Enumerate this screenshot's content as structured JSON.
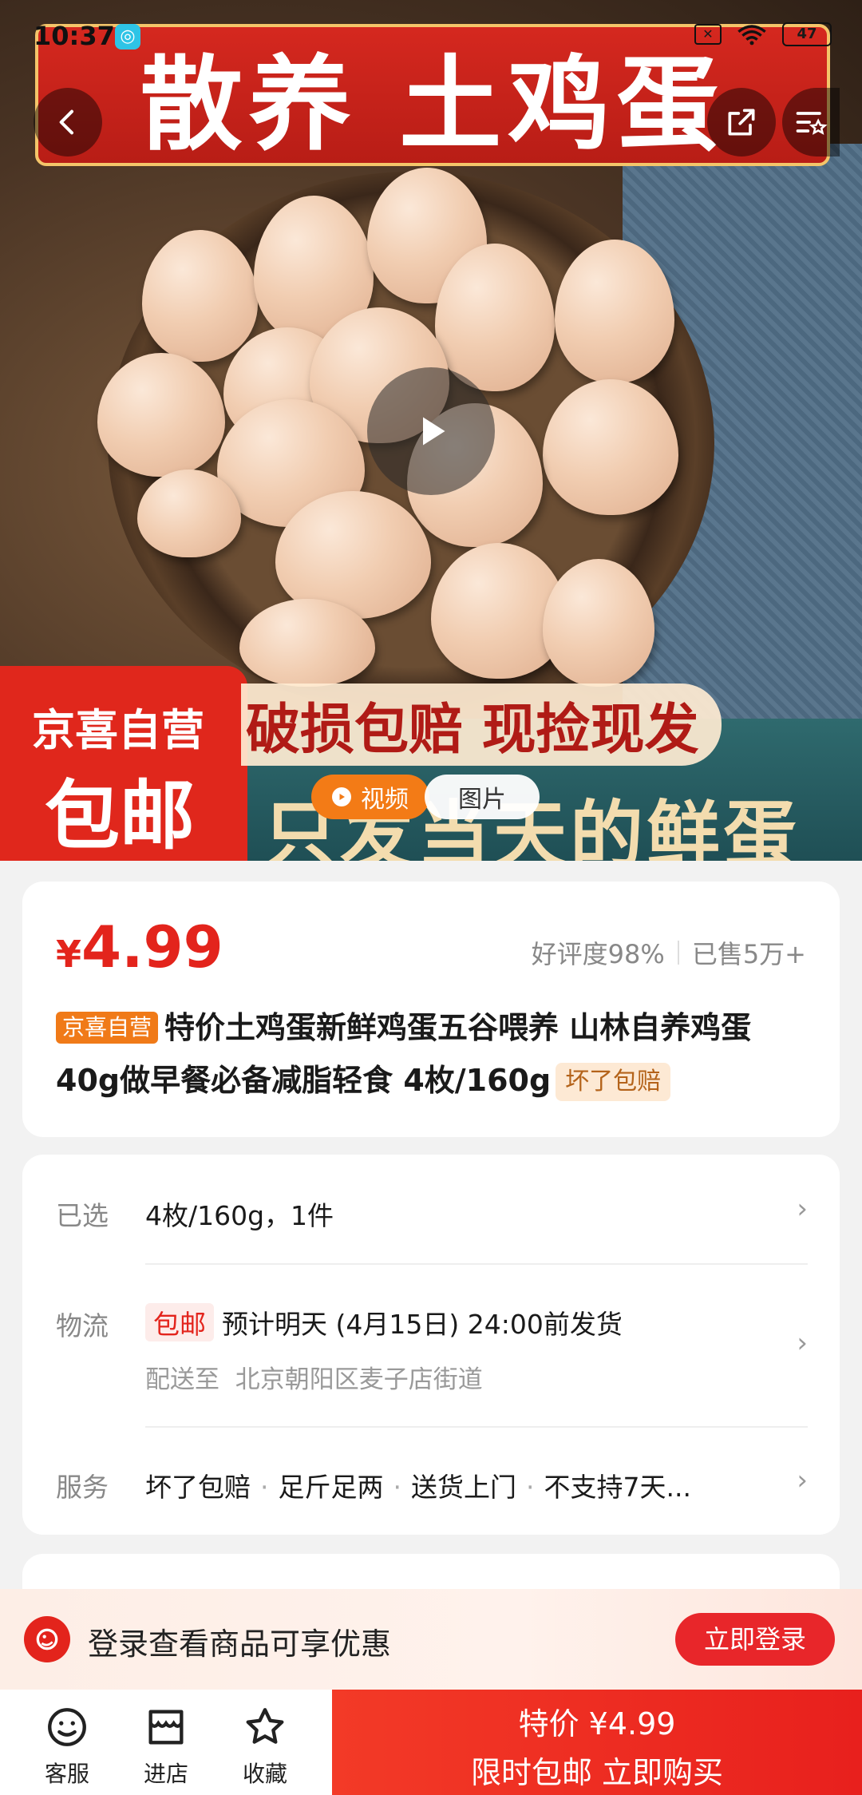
{
  "status_bar": {
    "time": "10:37",
    "battery": "47"
  },
  "hero": {
    "banner_title": "散养 土鸡蛋",
    "badge_line1": "京喜自营",
    "badge_line2": "包邮",
    "slogan1": "破损包赔 现捡现发",
    "slogan2": "只发当天的鲜蛋",
    "media_tabs": [
      {
        "label": "视频",
        "active": true
      },
      {
        "label": "图片",
        "active": false
      }
    ]
  },
  "product": {
    "price_symbol": "¥",
    "price": "4.99",
    "rating": "好评度98%",
    "sold": "已售5万+",
    "tag_store": "京喜自营",
    "title": "特价土鸡蛋新鲜鸡蛋五谷喂养 山林自养鸡蛋40g做早餐必备减脂轻食 4枚/160g",
    "tag_guarantee": "坏了包赔"
  },
  "info": {
    "selected_label": "已选",
    "selected_value": "4枚/160g，1件",
    "shipping_label": "物流",
    "shipping_badge": "包邮",
    "shipping_value": "预计明天 (4月15日) 24:00前发货",
    "shipping_to_label": "配送至",
    "shipping_to_value": "北京朝阳区麦子店街道",
    "service_label": "服务",
    "services": [
      "坏了包赔",
      "足斤足两",
      "送货上门",
      "不支持7天..."
    ]
  },
  "login_banner": {
    "text": "登录查看商品可享优惠",
    "button": "立即登录"
  },
  "bottom_nav": {
    "items": [
      {
        "label": "客服",
        "icon": "customer-service-icon"
      },
      {
        "label": "进店",
        "icon": "store-icon"
      },
      {
        "label": "收藏",
        "icon": "star-icon"
      }
    ],
    "buy_line1": "特价 ¥4.99",
    "buy_line2": "限时包邮 立即购买"
  },
  "colors": {
    "accent": "#e3241c",
    "orange": "#f07a18",
    "buy_button": "#f33a27"
  }
}
